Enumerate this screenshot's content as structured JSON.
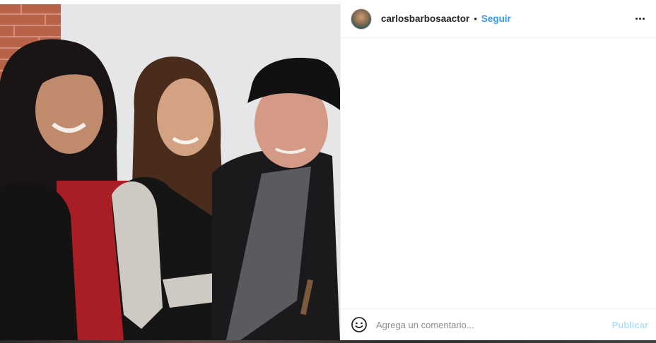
{
  "post": {
    "username": "carlosbarbosaactor",
    "separator": "•",
    "follow_label": "Seguir",
    "more_icon": "more-horizontal-icon",
    "photo_icon": "post-photo"
  },
  "comment_bar": {
    "emoji_icon": "emoji-smiley-icon",
    "placeholder": "Agrega un comentario...",
    "publish_label": "Publicar"
  },
  "colors": {
    "link_blue": "#3897f0",
    "publish_disabled": "#b2dffc",
    "text": "#262626",
    "placeholder": "#8e8e8e",
    "border": "#efefef"
  }
}
